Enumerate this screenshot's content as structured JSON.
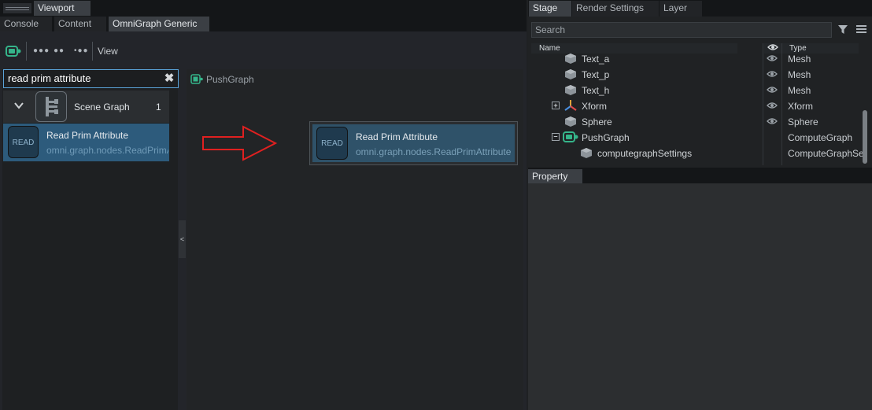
{
  "left_window": {
    "top_tab": "Viewport",
    "tabs": [
      "Console",
      "Content",
      "OmniGraph Generic"
    ],
    "toolbar": {
      "view_label": "View"
    },
    "search": {
      "value": "read prim attribute"
    },
    "category": {
      "label": "Scene Graph",
      "count": "1"
    },
    "result": {
      "badge": "READ",
      "title": "Read Prim Attribute",
      "subtitle": "omni.graph.nodes.ReadPrimAttribute"
    },
    "graph": {
      "title": "PushGraph",
      "node": {
        "badge": "READ",
        "title": "Read Prim Attribute",
        "subtitle": "omni.graph.nodes.ReadPrimAttribute"
      }
    },
    "collapse_handle": "<"
  },
  "right_window": {
    "tabs": [
      "Stage",
      "Render Settings",
      "Layer"
    ],
    "search_placeholder": "Search",
    "columns": {
      "name": "Name",
      "type": "Type"
    },
    "rows": [
      {
        "name": "Text_a",
        "type": "Mesh"
      },
      {
        "name": "Text_p",
        "type": "Mesh"
      },
      {
        "name": "Text_h",
        "type": "Mesh"
      },
      {
        "name": "Xform",
        "type": "Xform"
      },
      {
        "name": "Sphere",
        "type": "Sphere"
      },
      {
        "name": "PushGraph",
        "type": "ComputeGraph"
      },
      {
        "name": "computegraphSettings",
        "type": "ComputeGraphSettings"
      }
    ],
    "property_tab": "Property"
  },
  "colors": {
    "accent_blue": "#5aa3d8",
    "selection": "#2d5b7c",
    "arrow_red": "#e02020",
    "graph_green": "#35b58a"
  }
}
